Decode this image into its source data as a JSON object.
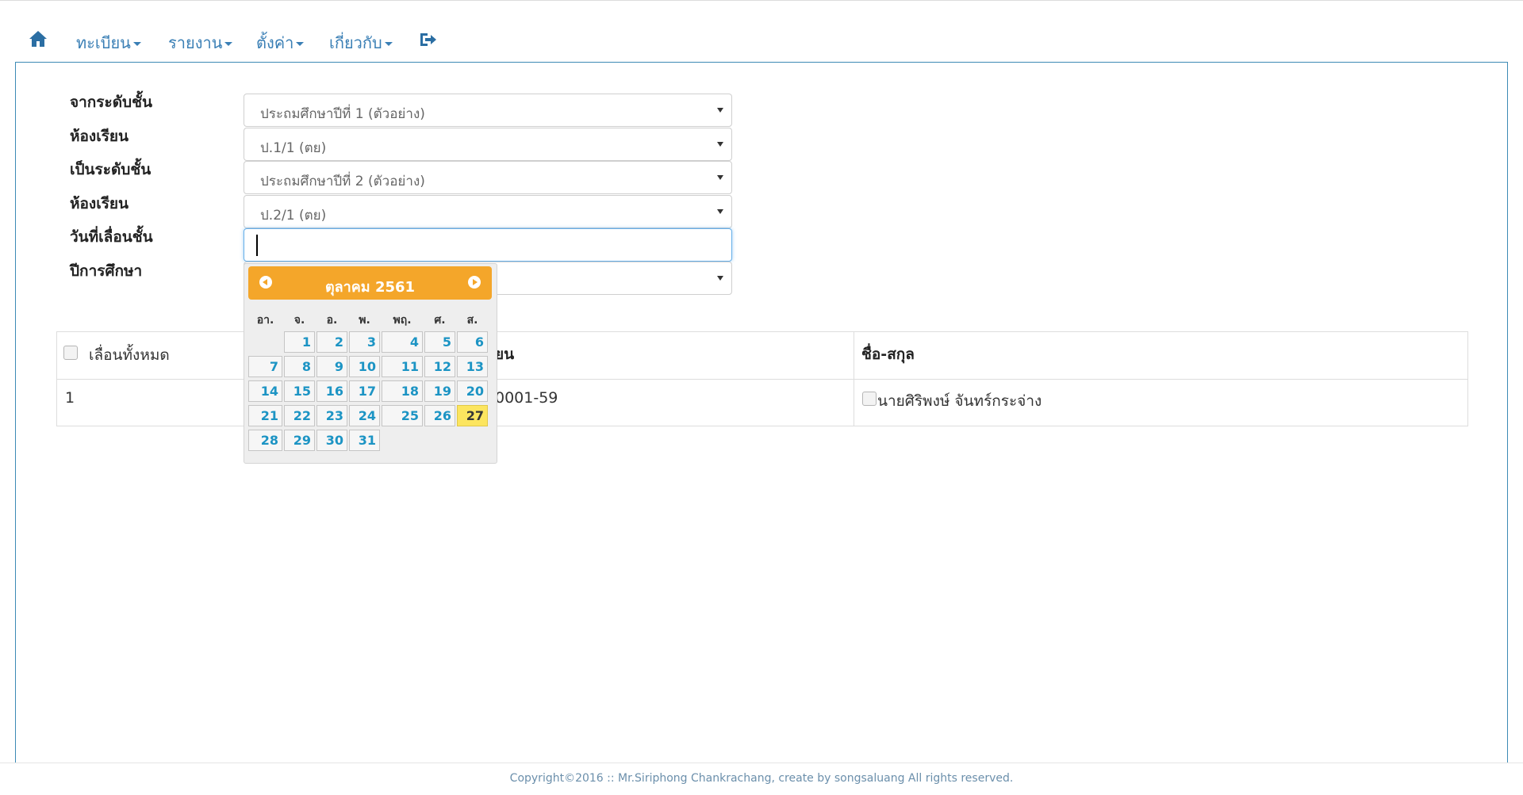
{
  "nav": {
    "items": [
      {
        "label": "ทะเบียน"
      },
      {
        "label": "รายงาน"
      },
      {
        "label": "ตั้งค่า"
      },
      {
        "label": "เกี่ยวกับ"
      }
    ],
    "home_icon": "home-icon",
    "logout_icon": "sign-out-icon",
    "link_color": "#3a7fb5"
  },
  "form": {
    "from_level_label": "จากระดับชั้น",
    "from_level_value": "ประถมศึกษาปีที่ 1 (ตัวอย่าง)",
    "from_room_label": "ห้องเรียน",
    "from_room_value": "ป.1/1 (ตย)",
    "to_level_label": "เป็นระดับชั้น",
    "to_level_value": "ประถมศึกษาปีที่ 2 (ตัวอย่าง)",
    "to_room_label": "ห้องเรียน",
    "to_room_value": "ป.2/1 (ตย)",
    "promote_date_label": "วันที่เลื่อนชั้น",
    "promote_date_value": "",
    "academic_year_label": "ปีการศึกษา",
    "academic_year_value": ""
  },
  "calendar": {
    "title": "ตุลาคม 2561",
    "weekdays": [
      "อา.",
      "จ.",
      "อ.",
      "พ.",
      "พฤ.",
      "ศ.",
      "ส."
    ],
    "first_weekday_index": 1,
    "days_in_month": 31,
    "today": 27,
    "header_color": "#f4a62a",
    "today_color": "#fce55f"
  },
  "table": {
    "select_all_label": "เลื่อนทั้งหมด",
    "col2_header_partial": "ยน",
    "col3_header": "ชื่อ-สกุล",
    "rows": [
      {
        "no": "1",
        "id_partial": "0001-59",
        "name": "นายศิริพงษ์ จันทร์กระจ่าง"
      }
    ]
  },
  "footer": {
    "text": "Copyright©2016 :: Mr.Siriphong Chankrachang, create by songsaluang All rights reserved."
  }
}
